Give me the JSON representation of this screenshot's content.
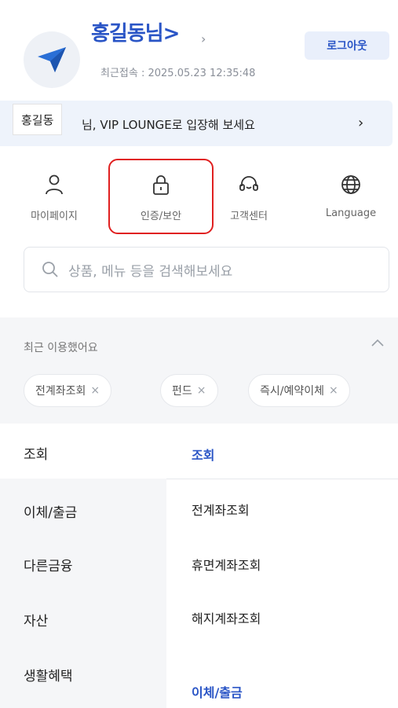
{
  "profile": {
    "user_name": "홍길동님>",
    "chevron": "›",
    "last_login": "최근접속 : 2025.05.23 12:35:48",
    "logout_label": "로그아웃"
  },
  "vip_banner": {
    "text": "님, VIP LOUNGE로 입장해 보세요",
    "chevron": "›"
  },
  "name_tooltip": "홍길동",
  "quick_menu": [
    {
      "label": "마이페이지",
      "icon": "person-icon"
    },
    {
      "label": "인증/보안",
      "icon": "lock-icon"
    },
    {
      "label": "고객센터",
      "icon": "headset-icon"
    },
    {
      "label": "Language",
      "icon": "globe-icon"
    }
  ],
  "search": {
    "placeholder": "상품, 메뉴 등을 검색해보세요"
  },
  "recent": {
    "title": "최근 이용했어요",
    "collapse_icon": "chevron-up-icon",
    "chips": [
      {
        "label": "전계좌조회",
        "remove": "×"
      },
      {
        "label": "펀드",
        "remove": "×"
      },
      {
        "label": "즉시/예약이체",
        "remove": "×"
      }
    ]
  },
  "categories": [
    "조회",
    "이체/출금",
    "다른금융",
    "자산",
    "생활혜택"
  ],
  "submenu": {
    "heading1": "조회",
    "items": [
      "전계좌조회",
      "휴면계좌조회",
      "해지계좌조회"
    ],
    "heading2": "이체/출금"
  },
  "colors": {
    "accent": "#2a55c6",
    "highlight": "#e02020",
    "panel": "#f5f6f8",
    "banner": "#eef3fb"
  }
}
